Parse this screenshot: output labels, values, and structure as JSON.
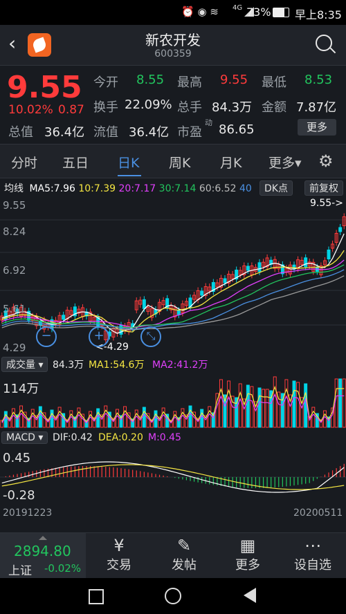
{
  "status": {
    "signal": "4G",
    "battery": "73%",
    "time": "早上8:35"
  },
  "header": {
    "title": "新农开发",
    "code": "600359"
  },
  "quote": {
    "price": "9.55",
    "change_pct": "10.02%",
    "change": "0.87",
    "open_label": "今开",
    "open": "8.55",
    "high_label": "最高",
    "high": "9.55",
    "low_label": "最低",
    "low": "8.53",
    "turnover_label": "换手",
    "turnover": "22.09%",
    "volume_label": "总手",
    "volume": "84.3万",
    "amount_label": "金额",
    "amount": "7.87亿",
    "mktcap_label": "总值",
    "mktcap": "36.4亿",
    "float_label": "流值",
    "float": "36.4亿",
    "pe_label": "市盈",
    "pe_sup": "动",
    "pe": "86.65",
    "more_label": "更多"
  },
  "tabs": [
    "分时",
    "五日",
    "日K",
    "周K",
    "月K",
    "更多▾"
  ],
  "ma": {
    "label": "均线",
    "ma5": "MA5:7.96",
    "ma10": "10:7.39",
    "ma20": "20:7.17",
    "ma30": "30:7.14",
    "ma60": "60:6.52",
    "ma40": "40",
    "dk": "DK点",
    "fq": "前复权"
  },
  "price_axis": [
    "9.55",
    "8.24",
    "6.92",
    "5.61",
    "4.29"
  ],
  "price_annot": {
    "high": "9.55->",
    "low": "<-4.29"
  },
  "volume": {
    "label": "成交量 ▾",
    "vol": "84.3万",
    "ma1": "MA1:54.6万",
    "ma2": "MA2:41.2万",
    "axis": "114万"
  },
  "macd": {
    "label": "MACD ▾",
    "dif": "DIF:0.42",
    "dea": "DEA:0.20",
    "m": "M:0.45",
    "axis_top": "0.45",
    "axis_bottom": "-0.28"
  },
  "dates": {
    "start": "20191223",
    "end": "20200511"
  },
  "bottom": {
    "index_value": "2894.80",
    "index_name": "上证",
    "index_change": "-0.02%",
    "items": [
      {
        "label": "交易",
        "icon": "trade-icon"
      },
      {
        "label": "发帖",
        "icon": "post-icon"
      },
      {
        "label": "更多",
        "icon": "grid-icon"
      },
      {
        "label": "设自选",
        "icon": "dots-icon"
      }
    ]
  },
  "colors": {
    "up": "#ff3b3b",
    "down": "#00d4e6",
    "ma5": "#ffffff",
    "ma10": "#f5e642",
    "ma20": "#e040fb",
    "ma30": "#22c55e",
    "ma60": "#a0a0a0",
    "accent": "#4a90e2"
  }
}
